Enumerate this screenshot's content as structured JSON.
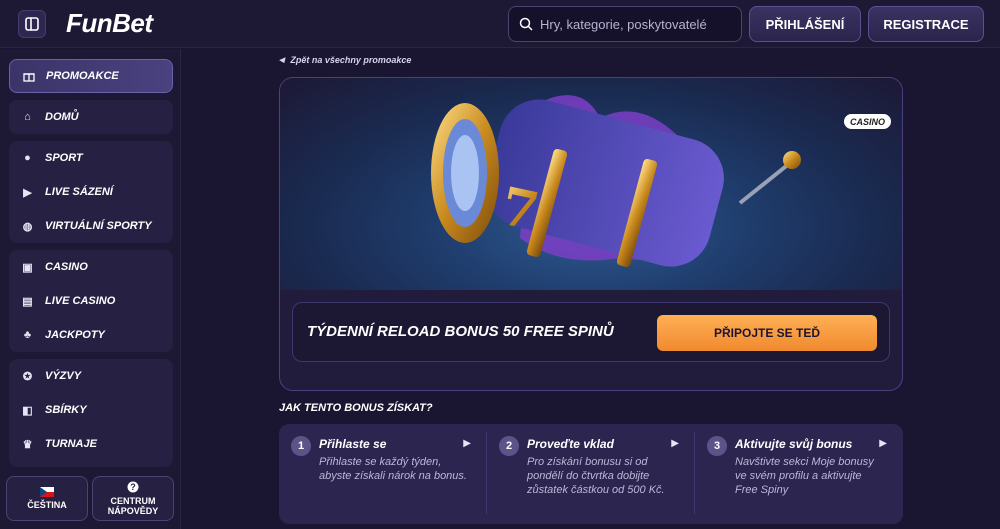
{
  "header": {
    "logo": "FunBet",
    "search_placeholder": "Hry, kategorie, poskytovatelé",
    "login": "PŘIHLÁŠENÍ",
    "register": "REGISTRACE"
  },
  "sidebar": {
    "promo": "PROMOAKCE",
    "groups": [
      {
        "items": [
          {
            "label": "DOMŮ",
            "icon": "home-icon"
          }
        ]
      },
      {
        "items": [
          {
            "label": "SPORT",
            "icon": "soccer-ball-icon"
          },
          {
            "label": "LIVE SÁZENÍ",
            "icon": "play-icon"
          },
          {
            "label": "VIRTUÁLNÍ SPORTY",
            "icon": "gamepad-icon"
          }
        ]
      },
      {
        "items": [
          {
            "label": "CASINO",
            "icon": "slot-icon"
          },
          {
            "label": "LIVE CASINO",
            "icon": "cards-icon"
          },
          {
            "label": "JACKPOTY",
            "icon": "clover-icon"
          }
        ]
      },
      {
        "items": [
          {
            "label": "VÝZVY",
            "icon": "medal-icon"
          },
          {
            "label": "SBÍRKY",
            "icon": "collection-icon"
          },
          {
            "label": "TURNAJE",
            "icon": "trophy-icon"
          }
        ]
      }
    ],
    "language": "ČEŠTINA",
    "help": "CENTRUM NÁPOVĚDY"
  },
  "main": {
    "back_link": "Zpět na všechny promoakce",
    "badge": "CASINO",
    "promo_title": "TÝDENNÍ RELOAD BONUS 50 FREE SPINŮ",
    "cta": "PŘIPOJTE SE TEĎ",
    "how_title": "JAK TENTO BONUS ZÍSKAT?",
    "steps": [
      {
        "num": "1",
        "title": "Přihlaste se",
        "text": "Přihlaste se každý týden, abyste získali nárok na bonus."
      },
      {
        "num": "2",
        "title": "Proveďte vklad",
        "text": "Pro získání bonusu si od pondělí do čtvrtka dobijte zůstatek částkou od 500 Kč."
      },
      {
        "num": "3",
        "title": "Aktivujte svůj bonus",
        "text": "Navštivte sekci Moje bonusy ve svém profilu a aktivujte Free Spiny"
      }
    ]
  },
  "colors": {
    "accent": "#f0892e",
    "background": "#1a1530",
    "panel": "#262042"
  }
}
